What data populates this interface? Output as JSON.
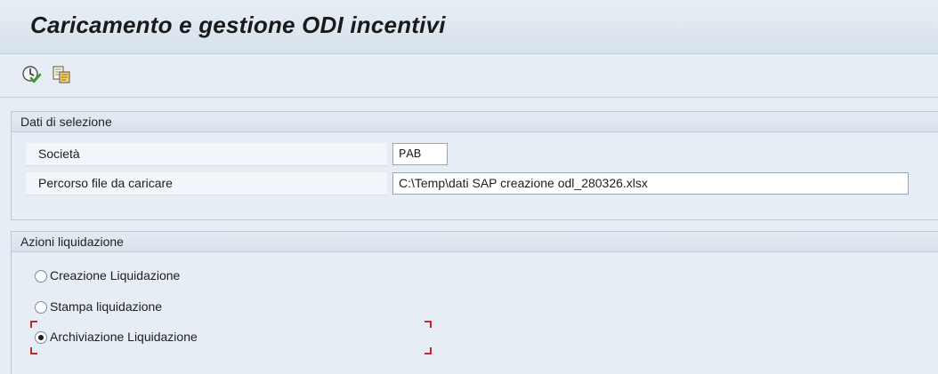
{
  "page": {
    "title": "Caricamento e gestione ODI incentivi"
  },
  "toolbar": {
    "items": [
      {
        "icon": "execute-icon"
      },
      {
        "icon": "copy-variant-icon"
      }
    ]
  },
  "selection": {
    "header": "Dati di selezione",
    "fields": [
      {
        "label": "Società",
        "value": "PAB"
      },
      {
        "label": "Percorso file da caricare",
        "value": "C:\\Temp\\dati SAP creazione odl_280326.xlsx"
      }
    ]
  },
  "actions": {
    "header": "Azioni liquidazione",
    "options": [
      {
        "label": "Creazione Liquidazione",
        "selected": false
      },
      {
        "label": "Stampa liquidazione",
        "selected": false
      },
      {
        "label": "Archiviazione Liquidazione",
        "selected": true
      }
    ]
  },
  "colors": {
    "focus_marker": "#c62828",
    "header_bg": "#d8e2ec",
    "page_bg": "#e6edf4"
  }
}
